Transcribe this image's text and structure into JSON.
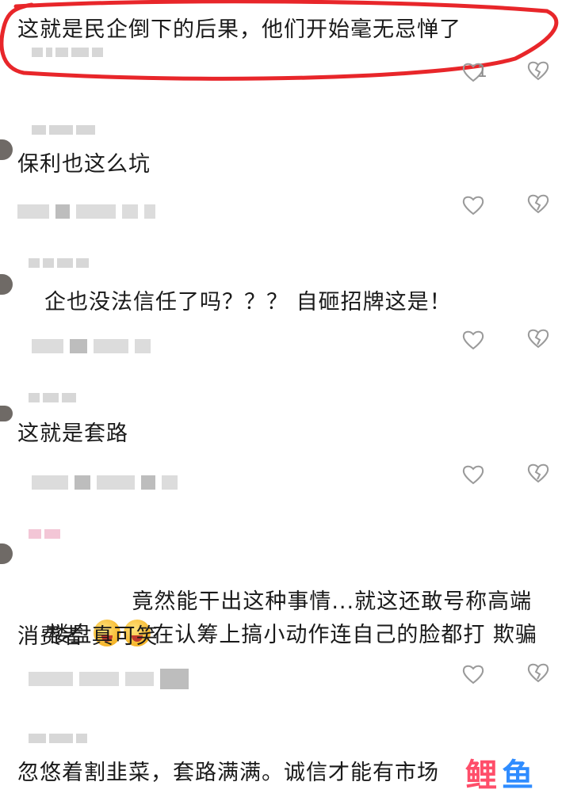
{
  "comments": [
    {
      "text": "这就是民企倒下的后果，他们开始毫无忌惮了",
      "likes": "1",
      "highlighted": true
    },
    {
      "text": "保利也这么坑",
      "likes": ""
    },
    {
      "text": "企也没法信任了吗？？？ 自砸招牌这是！",
      "likes": ""
    },
    {
      "text": "这就是套路",
      "likes": ""
    },
    {
      "text_line1": "竟然能干出这种事情...就这还敢号称高端",
      "text_line2a": "楼盘",
      "text_line2b": "在认筹上搞小动作连自己的脸都打 欺骗",
      "text_line3": "消费者 真可笑",
      "likes": ""
    },
    {
      "text": "忽悠着割韭菜，套路满满。诚信才能有市场",
      "likes": ""
    }
  ],
  "watermark": {
    "text": "鲤鱼",
    "color_a": "#ff4e6a",
    "color_b": "#2f8cff"
  },
  "colors": {
    "highlight": "#e8262a",
    "icon": "#9a9a9a",
    "blur": "#d7d7d7"
  },
  "icons": {
    "like": "heart-outline-icon",
    "dislike": "broken-heart-icon",
    "emoji": "laughing-face-emoji"
  }
}
